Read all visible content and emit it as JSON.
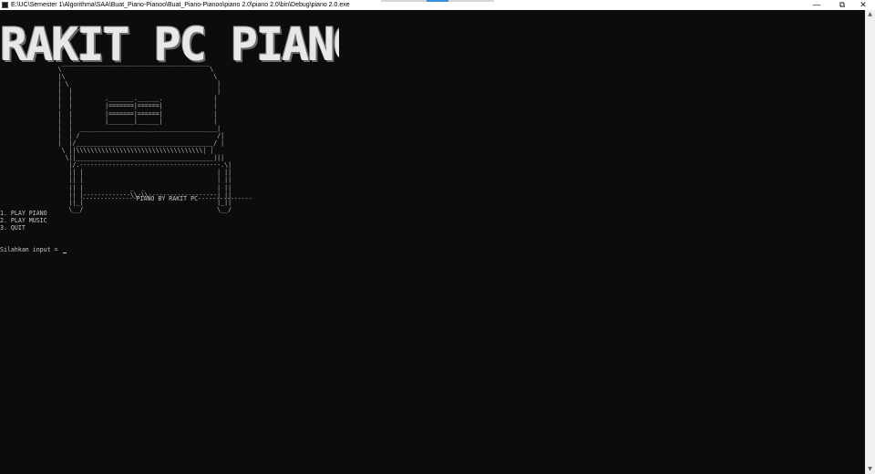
{
  "window": {
    "title": "E:\\UC\\Semester 1\\Algorithma\\SAA\\Buat_Piano-Pianoo\\Buat_Piano-Pianoo\\piano 2.0\\piano 2.0\\bin\\Debug\\piano 2.0.exe",
    "minimize_glyph": "—",
    "maximize_glyph": "⧉",
    "close_glyph": "✕"
  },
  "console": {
    "banner": "RAKIT PC PIANO",
    "piano_art": "                \\‾‾‾‾‾‾‾‾‾‾‾‾‾‾‾‾‾‾‾‾‾‾‾‾‾‾‾‾‾‾‾‾‾‾‾‾‾‾‾‾‾\\\n                |\\                                         \\\n                | \\                                         |\n                |  |                                        |\n                |  |         ._______.______.              |\n                |  |         |=======|======|              |\n                |  |         |=======|======|              |\n                |  |         |_______|______|              |\n                |  |  ______________________________________|\n                |  | /                                      /|\n                |  |/______________________________________/ |\n                 \\ ||\\\\\\\\\\\\\\\\\\\\\\\\\\\\\\\\\\\\\\\\\\\\\\\\\\\\\\\\\\\\\\\\\\\\\\| |\n                  \\||______________________________________|||\n                   |/.---------------------------------------.\\|\n                   || |                                     | ||\n                   || |                                     | ||\n                   || |             _  _                    | ||\n                   || |-------------\\\\-\\\\-------------------| ||\n                   ||_|                                     |_||\n                   \\__/                                     \\__/",
    "caption": "---------------PIANO BY RAKIT PC---------------",
    "menu": [
      "1. PLAY PIANO",
      "2. PLAY MUSIC",
      "3. QUIT"
    ],
    "prompt": "Silahkan input = "
  },
  "scrollbar": {
    "up_glyph": "▲",
    "down_glyph": "▼"
  }
}
